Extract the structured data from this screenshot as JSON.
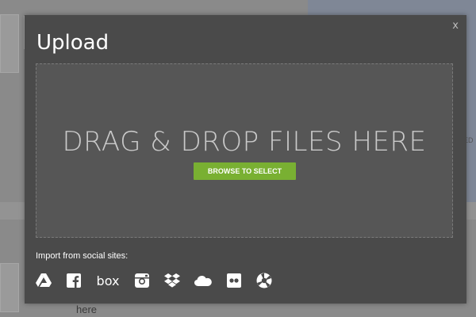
{
  "background": {
    "partial_text": "here",
    "edge_text": "ED"
  },
  "modal": {
    "title": "Upload",
    "close_label": "x",
    "drop_zone": {
      "text": "DRAG & DROP FILES HERE",
      "browse_label": "BROWSE TO SELECT"
    },
    "import_label": "Import from social sites:",
    "social_sites": [
      {
        "name": "Google Drive",
        "icon": "google-drive-icon"
      },
      {
        "name": "Facebook",
        "icon": "facebook-icon"
      },
      {
        "name": "Box",
        "icon": "box-icon",
        "text": "box"
      },
      {
        "name": "Instagram",
        "icon": "instagram-icon"
      },
      {
        "name": "Dropbox",
        "icon": "dropbox-icon"
      },
      {
        "name": "OneDrive",
        "icon": "onedrive-icon"
      },
      {
        "name": "Flickr",
        "icon": "flickr-icon"
      },
      {
        "name": "Picasa",
        "icon": "picasa-icon"
      }
    ]
  },
  "colors": {
    "modal_bg": "#4a4a4a",
    "drop_zone_bg": "#565656",
    "browse_button": "#79b032"
  }
}
